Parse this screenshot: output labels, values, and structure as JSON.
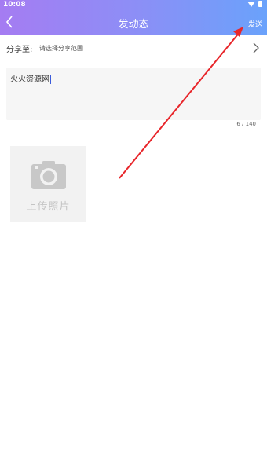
{
  "status_bar": {
    "time": "10:08",
    "wifi_icon": "wifi-icon",
    "battery_icon": "battery-icon"
  },
  "header": {
    "back_icon": "chevron-left-icon",
    "title": "发动态",
    "send_label": "发送"
  },
  "share": {
    "label": "分享至:",
    "value": "请选择分享范围",
    "chevron_icon": "chevron-right-icon"
  },
  "editor": {
    "value": "火火资源网",
    "counter": "6 / 140"
  },
  "upload": {
    "icon": "camera-icon",
    "label": "上传照片"
  },
  "annotation": {
    "color": "#e8262b"
  },
  "colors": {
    "header_start": "#a57cf2",
    "header_end": "#6aa2fb",
    "placeholder_gray": "#c4c4c4"
  }
}
